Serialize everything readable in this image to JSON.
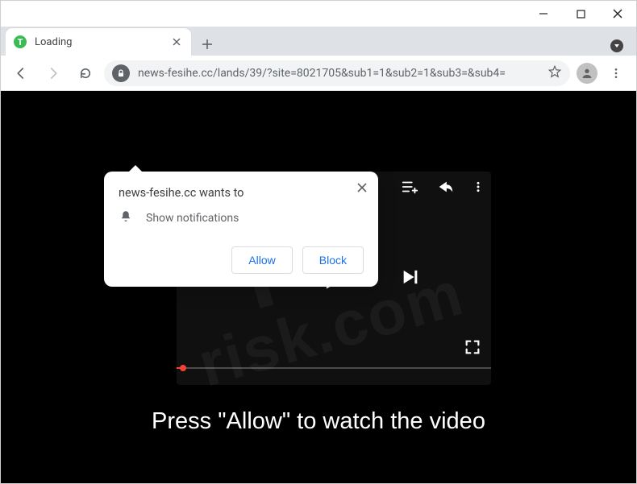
{
  "tab": {
    "title": "Loading"
  },
  "address": {
    "url": "news-fesihe.cc/lands/39/?site=8021705&sub1=1&sub2=1&sub3=&sub4="
  },
  "notif": {
    "site": "news-fesihe.cc",
    "wants_to": "wants to",
    "permission_label": "Show notifications",
    "allow_label": "Allow",
    "block_label": "Block"
  },
  "page": {
    "caption": "Press \"Allow\" to watch the video"
  },
  "watermark": {
    "top": "PC",
    "bottom": "risk.com"
  }
}
